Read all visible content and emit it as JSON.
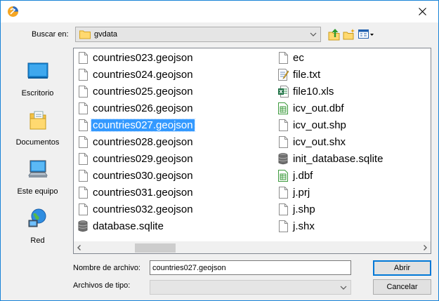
{
  "dialog": {
    "app_icon": "app-logo-icon",
    "close_icon": "close-icon"
  },
  "toolbar": {
    "look_in_label": "Buscar en:",
    "look_in_value": "gvdata",
    "up_icon": "up-folder-icon",
    "new_folder_icon": "new-folder-icon",
    "view_menu_icon": "view-menu-icon"
  },
  "places": [
    {
      "label": "Escritorio",
      "icon": "desktop-icon"
    },
    {
      "label": "Documentos",
      "icon": "documents-icon"
    },
    {
      "label": "Este equipo",
      "icon": "computer-icon"
    },
    {
      "label": "Red",
      "icon": "network-icon"
    }
  ],
  "files": {
    "selected": "countries027.geojson",
    "column1": [
      {
        "name": "countries023.geojson",
        "icon": "file-icon"
      },
      {
        "name": "countries024.geojson",
        "icon": "file-icon"
      },
      {
        "name": "countries025.geojson",
        "icon": "file-icon"
      },
      {
        "name": "countries026.geojson",
        "icon": "file-icon"
      },
      {
        "name": "countries027.geojson",
        "icon": "file-icon"
      },
      {
        "name": "countries028.geojson",
        "icon": "file-icon"
      },
      {
        "name": "countries029.geojson",
        "icon": "file-icon"
      },
      {
        "name": "countries030.geojson",
        "icon": "file-icon"
      },
      {
        "name": "countries031.geojson",
        "icon": "file-icon"
      },
      {
        "name": "countries032.geojson",
        "icon": "file-icon"
      },
      {
        "name": "database.sqlite",
        "icon": "database-icon"
      }
    ],
    "column2": [
      {
        "name": "ec",
        "icon": "file-icon"
      },
      {
        "name": "file.txt",
        "icon": "text-file-icon"
      },
      {
        "name": "file10.xls",
        "icon": "excel-file-icon"
      },
      {
        "name": "icv_out.dbf",
        "icon": "dbf-file-icon"
      },
      {
        "name": "icv_out.shp",
        "icon": "file-icon"
      },
      {
        "name": "icv_out.shx",
        "icon": "file-icon"
      },
      {
        "name": "init_database.sqlite",
        "icon": "database-icon"
      },
      {
        "name": "j.dbf",
        "icon": "dbf-file-icon"
      },
      {
        "name": "j.prj",
        "icon": "file-icon"
      },
      {
        "name": "j.shp",
        "icon": "file-icon"
      },
      {
        "name": "j.shx",
        "icon": "file-icon"
      }
    ]
  },
  "footer": {
    "filename_label": "Nombre de archivo:",
    "filename_value": "countries027.geojson",
    "filetype_label": "Archivos de tipo:",
    "filetype_value": "",
    "open_label": "Abrir",
    "cancel_label": "Cancelar"
  },
  "colors": {
    "selection": "#3399ff",
    "window_border": "#1883d7",
    "dialog_bg": "#f0f0f0"
  }
}
